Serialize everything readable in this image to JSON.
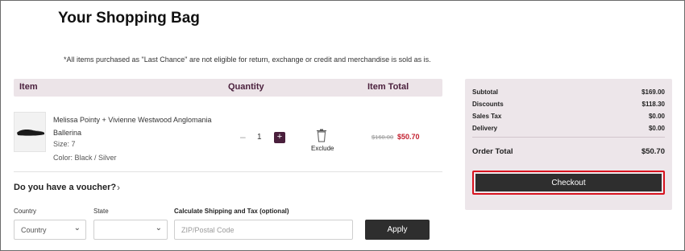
{
  "page": {
    "title": "Your Shopping Bag",
    "notice": "*All items purchased as \"Last Chance\" are not eligible for return, exchange or credit and merchandise is sold as is."
  },
  "table_header": {
    "item": "Item",
    "quantity": "Quantity",
    "item_total": "Item Total"
  },
  "cart_item": {
    "name": "Melissa Pointy + Vivienne Westwood Anglomania Ballerina",
    "size": "Size: 7",
    "color": "Color: Black / Silver",
    "quantity": "1",
    "minus_glyph": "–",
    "plus_glyph": "+",
    "exclude_label": "Exclude",
    "price_original": "$160.00",
    "price_sale": "$50.70",
    "thumbnail_icon": "shoe-icon",
    "trash_icon": "trash-icon"
  },
  "voucher": {
    "label": "Do you have a voucher?",
    "chevron": "›"
  },
  "shipping_form": {
    "country_label": "Country",
    "country_value": "Country",
    "state_label": "State",
    "state_value": "",
    "calc_label": "Calculate Shipping and Tax (optional)",
    "zip_placeholder": "ZIP/Postal Code",
    "apply_label": "Apply",
    "chevron": "⌄"
  },
  "summary": {
    "subtotal_label": "Subtotal",
    "subtotal_value": "$169.00",
    "discounts_label": "Discounts",
    "discounts_value": "$118.30",
    "tax_label": "Sales Tax",
    "tax_value": "$0.00",
    "delivery_label": "Delivery",
    "delivery_value": "$0.00",
    "total_label": "Order Total",
    "total_value": "$50.70",
    "checkout_label": "Checkout"
  },
  "colors": {
    "accent": "#4a1f3c",
    "header_bg": "#ece4e8",
    "summary_bg": "#ede6ea",
    "sale_red": "#c3202f",
    "button_dark": "#2e2e2e",
    "focus_outline": "#d8131f"
  }
}
